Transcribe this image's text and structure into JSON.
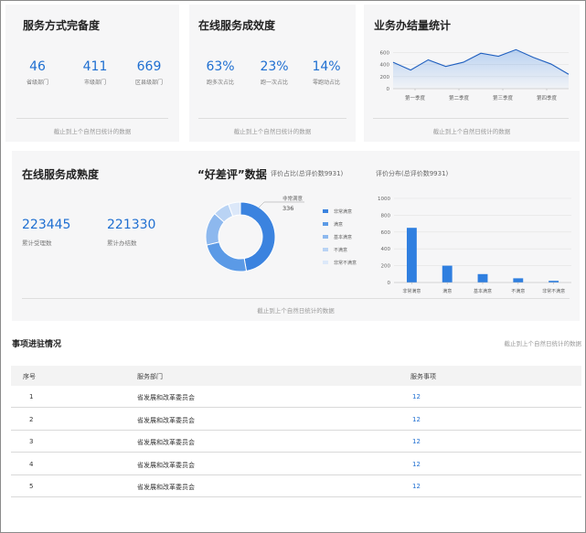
{
  "colors": {
    "accent": "#1f6fd1",
    "card_bg": "#f6f6f7"
  },
  "completeness": {
    "title": "服务方式完备度",
    "stats": [
      {
        "value": "46",
        "label": "省级部门"
      },
      {
        "value": "411",
        "label": "市级部门"
      },
      {
        "value": "669",
        "label": "区县级部门"
      }
    ],
    "footer": "截止到上个自然日统计的数据"
  },
  "effectiveness": {
    "title": "在线服务成效度",
    "stats": [
      {
        "value": "63%",
        "label": "跑多次占比"
      },
      {
        "value": "23%",
        "label": "跑一次占比"
      },
      {
        "value": "14%",
        "label": "零跑动占比"
      }
    ],
    "footer": "截止到上个自然日统计的数据"
  },
  "volume": {
    "title": "业务办结量统计",
    "footer": "截止到上个自然日统计的数据"
  },
  "maturity": {
    "title": "在线服务成熟度",
    "stats": [
      {
        "value": "223445",
        "label": "累计受理数"
      },
      {
        "value": "221330",
        "label": "累计办结数"
      }
    ],
    "rating_title": "“好差评”数据",
    "pie_subtitle": "评价占比(总评价数9931)",
    "bar_subtitle": "评价分布(总评价数9931)",
    "pie_callout_label": "非常满意",
    "pie_callout_value": "336",
    "footer": "截止到上个自然日统计的数据"
  },
  "progress": {
    "title": "事项进驻情况",
    "note": "截止到上个自然日统计的数据",
    "columns": [
      "序号",
      "服务部门",
      "服务事项"
    ],
    "rows": [
      {
        "no": "1",
        "dept": "省发展和改革委员会",
        "count": "12"
      },
      {
        "no": "2",
        "dept": "省发展和改革委员会",
        "count": "12"
      },
      {
        "no": "3",
        "dept": "省发展和改革委员会",
        "count": "12"
      },
      {
        "no": "4",
        "dept": "省发展和改革委员会",
        "count": "12"
      },
      {
        "no": "5",
        "dept": "省发展和改革委员会",
        "count": "12"
      }
    ]
  },
  "chart_data": [
    {
      "type": "line",
      "categories": [
        "第一季度",
        "第二季度",
        "第三季度",
        "第四季度"
      ],
      "x_ticks": [
        "第一季度",
        "第二季度",
        "第三季度",
        "第四季度"
      ],
      "y_ticks": [
        "0",
        "200",
        "400",
        "600"
      ],
      "ylim": [
        0,
        700
      ],
      "grid": true,
      "series": [
        {
          "values": [
            440,
            310,
            480,
            370,
            440,
            590,
            540,
            650,
            520,
            410,
            240
          ]
        }
      ]
    },
    {
      "type": "pie",
      "donut": true,
      "slices": [
        {
          "name": "非常满意",
          "value": 336,
          "color": "#3b83df"
        },
        {
          "name": "满意",
          "value": 170,
          "color": "#5b9ae6"
        },
        {
          "name": "基本满意",
          "value": 110,
          "color": "#8db8ee"
        },
        {
          "name": "不满意",
          "value": 55,
          "color": "#b9d3f4"
        },
        {
          "name": "非常不满意",
          "value": 40,
          "color": "#dce8f9"
        }
      ],
      "legend": [
        "非常满意",
        "满意",
        "基本满意",
        "不满意",
        "非常不满意"
      ],
      "legend_position": "right"
    },
    {
      "type": "bar",
      "categories": [
        "非常满意",
        "满意",
        "基本满意",
        "不满意",
        "非常不满意"
      ],
      "values": [
        650,
        200,
        100,
        50,
        20
      ],
      "y_ticks": [
        "0",
        "200",
        "400",
        "600",
        "800",
        "1000"
      ],
      "ylim": [
        0,
        1000
      ],
      "grid": true,
      "color": "#2f7fe0"
    }
  ]
}
